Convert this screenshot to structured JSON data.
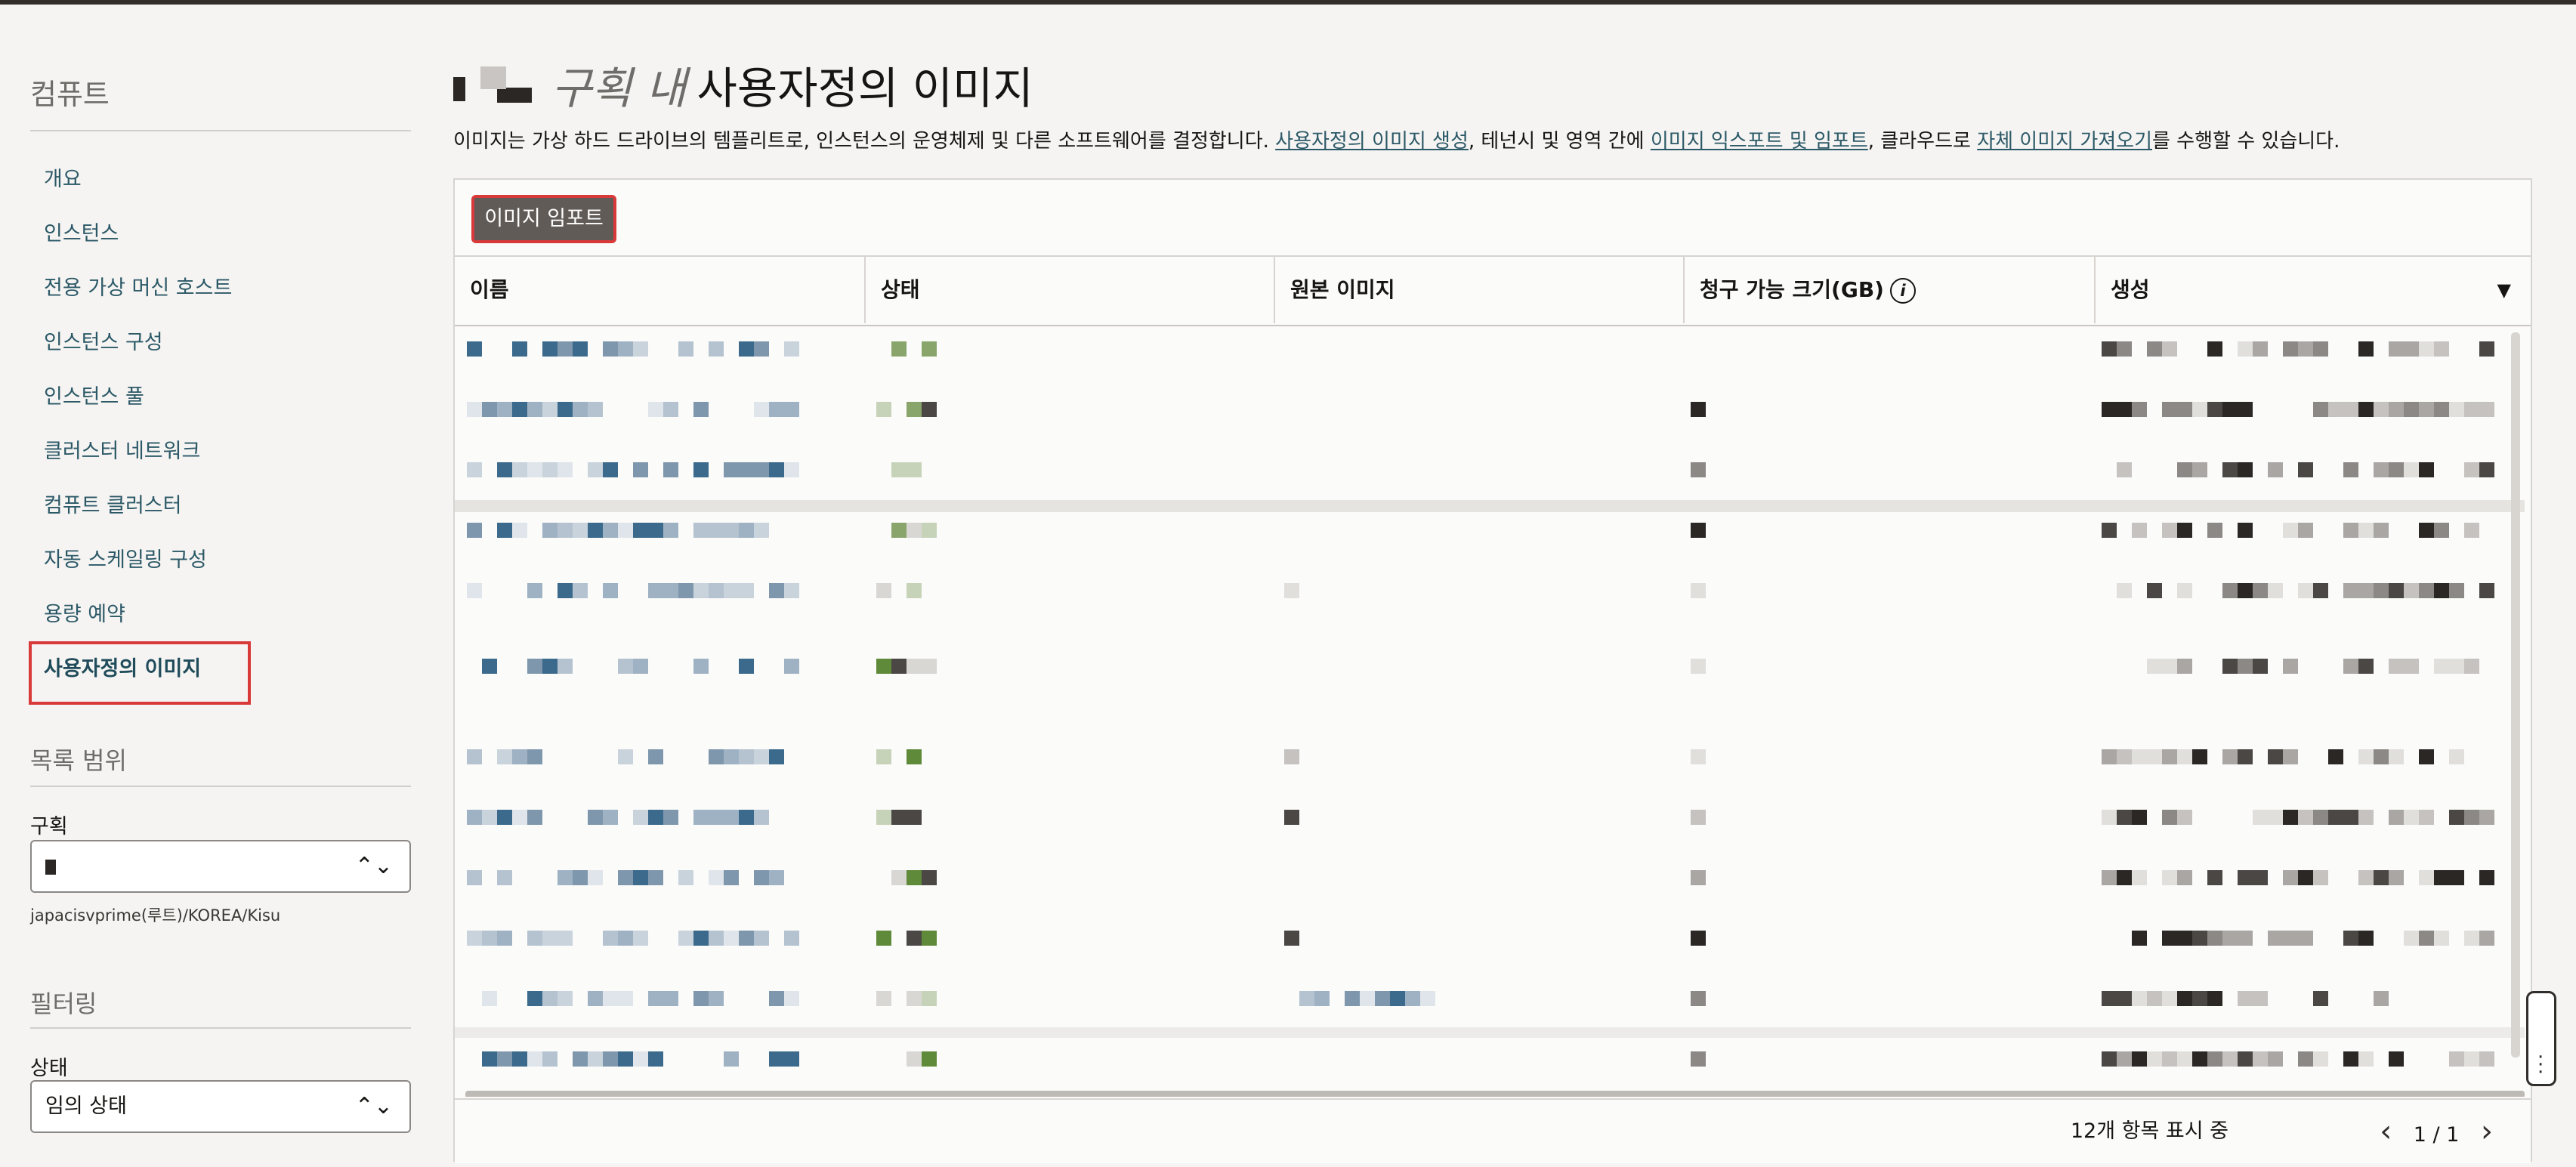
{
  "sidebar": {
    "section_title": "컴퓨트",
    "nav_items": [
      {
        "label": "개요"
      },
      {
        "label": "인스턴스"
      },
      {
        "label": "전용 가상 머신 호스트"
      },
      {
        "label": "인스턴스 구성"
      },
      {
        "label": "인스턴스 풀"
      },
      {
        "label": "클러스터 네트워크"
      },
      {
        "label": "컴퓨트 클러스터"
      },
      {
        "label": "자동 스케일링 구성"
      },
      {
        "label": "용량 예약"
      },
      {
        "label": "사용자정의 이미지"
      }
    ],
    "active_index": 9,
    "scope_title": "목록 범위",
    "compartment_label": "구획",
    "compartment_value": "",
    "compartment_path": "japacisvprime(루트)/KOREA/Kisu",
    "filter_title": "필터링",
    "state_label": "상태",
    "state_value": "임의 상태"
  },
  "header": {
    "title_italic": "구획 내",
    "title_main": "사용자정의 이미지",
    "desc_before": "이미지는 가상 하드 드라이브의 템플리트로, 인스턴스의 운영체제 및 다른 소프트웨어를 결정합니다. ",
    "desc_link1": "사용자정의 이미지 생성",
    "desc_mid1": ", 테넌시 및 영역 간에 ",
    "desc_link2": "이미지 익스포트 및 임포트",
    "desc_mid2": ", 클라우드로 ",
    "desc_link3": "자체 이미지 가져오기",
    "desc_after": "를 수행할 수 있습니다."
  },
  "toolbar": {
    "import_label": "이미지 임포트"
  },
  "table": {
    "columns": [
      "이름",
      "상태",
      "원본 이미지",
      "청구 가능 크기(GB)",
      "생성"
    ],
    "info_icon": "i",
    "sort_icon": "caret-down-icon",
    "row_count": 12
  },
  "footer": {
    "count_text": "12개 항목 표시 중",
    "page_text": "1 / 1"
  },
  "colors": {
    "accent_link": "#2c5967",
    "button_bg": "#615b57",
    "highlight_border": "#d83a3a",
    "status_green": "#5f8a3a"
  }
}
